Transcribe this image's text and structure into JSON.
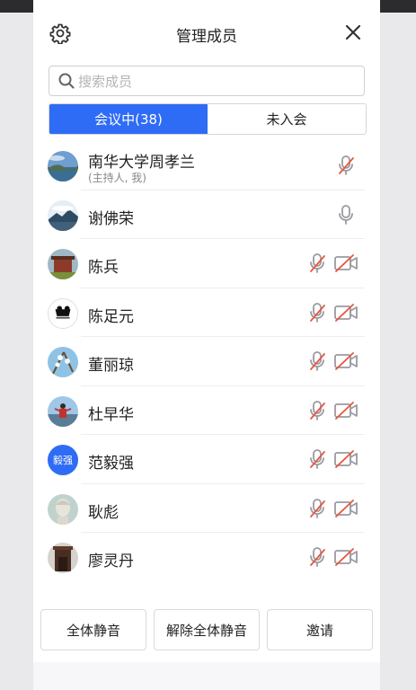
{
  "header": {
    "title": "管理成员"
  },
  "search": {
    "placeholder": "搜索成员"
  },
  "tabs": [
    {
      "label": "会议中(38)",
      "active": true
    },
    {
      "label": "未入会",
      "active": false
    }
  ],
  "members": [
    {
      "name": "南华大学周孝兰",
      "sub": "(主持人, 我)",
      "mic": "muted",
      "cam": "none",
      "avatar": "photo"
    },
    {
      "name": "谢佛荣",
      "sub": "",
      "mic": "on",
      "cam": "none",
      "avatar": "photo"
    },
    {
      "name": "陈兵",
      "sub": "",
      "mic": "muted",
      "cam": "off",
      "avatar": "photo"
    },
    {
      "name": "陈足元",
      "sub": "",
      "mic": "muted",
      "cam": "off",
      "avatar": "photo"
    },
    {
      "name": "董丽琼",
      "sub": "",
      "mic": "muted",
      "cam": "off",
      "avatar": "photo"
    },
    {
      "name": "杜早华",
      "sub": "",
      "mic": "muted",
      "cam": "off",
      "avatar": "photo"
    },
    {
      "name": "范毅强",
      "sub": "",
      "mic": "muted",
      "cam": "off",
      "avatar": "text",
      "avatar_text": "毅强"
    },
    {
      "name": "耿彪",
      "sub": "",
      "mic": "muted",
      "cam": "off",
      "avatar": "photo"
    },
    {
      "name": "廖灵丹",
      "sub": "",
      "mic": "muted",
      "cam": "off",
      "avatar": "photo"
    }
  ],
  "footer": {
    "mute_all": "全体静音",
    "unmute_all": "解除全体静音",
    "invite": "邀请"
  },
  "colors": {
    "accent": "#2f6cf6",
    "muted_slash": "#e8563f",
    "icon_gray": "#9a9aa0"
  }
}
